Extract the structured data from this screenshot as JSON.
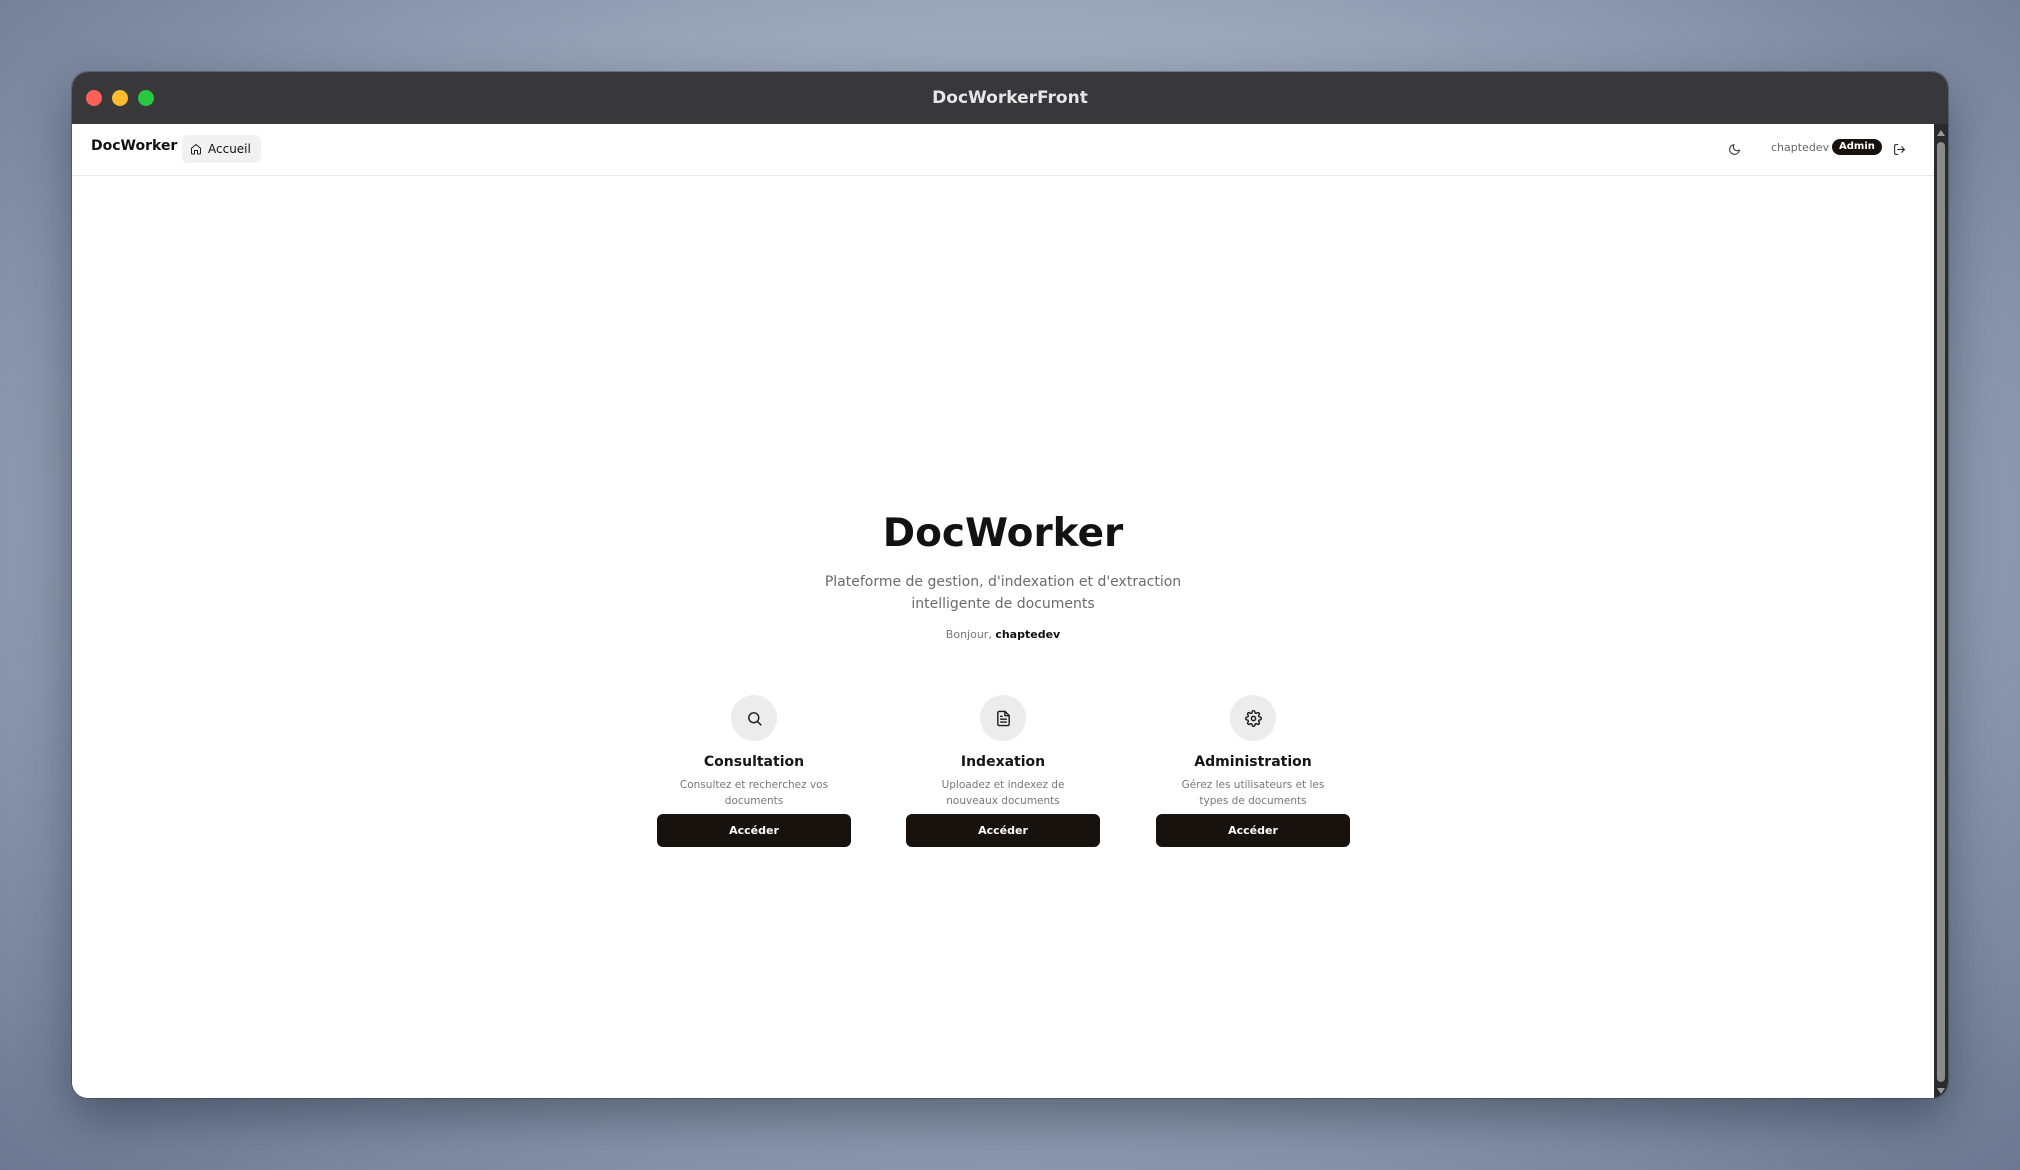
{
  "window": {
    "title": "DocWorkerFront"
  },
  "navbar": {
    "brand": "DocWorker",
    "home_label": "Accueil",
    "username": "chaptedev",
    "role_badge": "Admin"
  },
  "hero": {
    "title": "DocWorker",
    "subtitle": "Plateforme de gestion, d'indexation et d'extraction intelligente de documents",
    "greeting_prefix": "Bonjour,",
    "greeting_name": "chaptedev"
  },
  "cards": [
    {
      "icon": "search-icon",
      "title": "Consultation",
      "description": "Consultez et recherchez vos documents",
      "button": "Accéder"
    },
    {
      "icon": "document-icon",
      "title": "Indexation",
      "description": "Uploadez et indexez de nouveaux documents",
      "button": "Accéder"
    },
    {
      "icon": "gear-icon",
      "title": "Administration",
      "description": "Gérez les utilisateurs et les types de documents",
      "button": "Accéder"
    }
  ],
  "colors": {
    "primary_button": "#18120f",
    "titlebar": "#38383a",
    "icon_circle": "#ececec"
  }
}
